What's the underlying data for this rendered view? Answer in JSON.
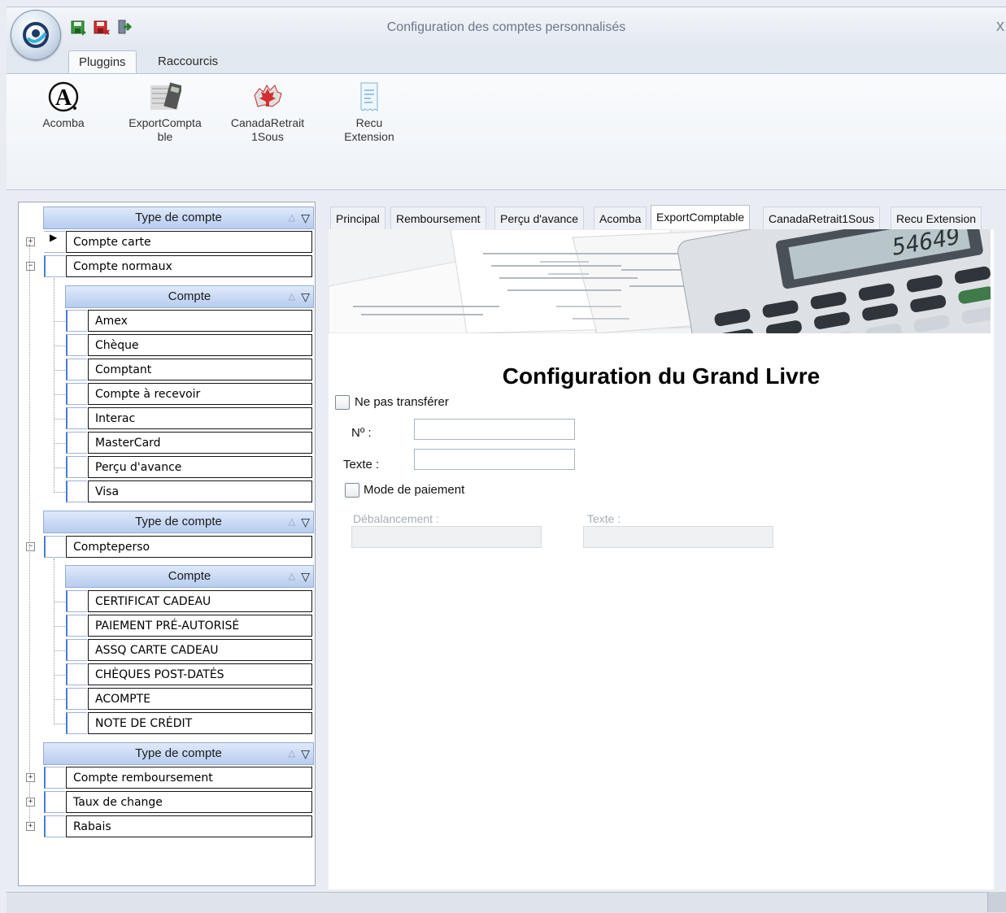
{
  "window": {
    "title": "Configuration des comptes personnalisés",
    "close_glyph": "x"
  },
  "quick_access": [
    {
      "icon": "save-icon",
      "color": "#2e7d32"
    },
    {
      "icon": "save-close-icon",
      "color": "#c62828"
    },
    {
      "icon": "exit-icon",
      "color": "#388e3c"
    }
  ],
  "ribbon": {
    "tabs": [
      "Pluggins",
      "Raccourcis"
    ],
    "active_tab": "Pluggins",
    "buttons": [
      {
        "label_line1": "Acomba",
        "label_line2": ""
      },
      {
        "label_line1": "ExportCompta",
        "label_line2": "ble"
      },
      {
        "label_line1": "CanadaRetrait",
        "label_line2": "1Sous"
      },
      {
        "label_line1": "Recu",
        "label_line2": "Extension"
      }
    ]
  },
  "tree": {
    "groups": [
      {
        "header": "Type de compte",
        "rows": [
          {
            "label": "Compte carte",
            "expander": "+",
            "current": true
          },
          {
            "label": "Compte normaux",
            "expander": "−",
            "current": false
          }
        ],
        "child": {
          "header": "Compte",
          "rows": [
            "Amex",
            "Chèque",
            "Comptant",
            "Compte à recevoir",
            "Interac",
            "MasterCard",
            "Perçu d'avance",
            "Visa"
          ]
        }
      },
      {
        "header": "Type de compte",
        "rows": [
          {
            "label": "Compteperso",
            "expander": "−",
            "current": false
          }
        ],
        "child": {
          "header": "Compte",
          "rows": [
            "CERTIFICAT CADEAU",
            "PAIEMENT PRÉ-AUTORISÉ",
            "ASSQ CARTE CADEAU",
            "CHÈQUES POST-DATÉS",
            "ACOMPTE",
            "NOTE DE CRÉDIT"
          ]
        }
      },
      {
        "header": "Type de compte",
        "rows": [
          {
            "label": "Compte remboursement",
            "expander": "+",
            "current": false
          },
          {
            "label": "Taux de change",
            "expander": "+",
            "current": false
          },
          {
            "label": "Rabais",
            "expander": "+",
            "current": false
          }
        ]
      }
    ]
  },
  "content_tabs": {
    "items": [
      "Principal",
      "Remboursement",
      "Perçu d'avance",
      "Acomba",
      "ExportComptable",
      "CanadaRetrait1Sous",
      "Recu Extension"
    ],
    "active": "ExportComptable"
  },
  "banner": {
    "calculator_display": "54649"
  },
  "form": {
    "title": "Configuration du Grand Livre",
    "no_transfer_label": "Ne pas transférer",
    "no_transfer_checked": false,
    "number_label": "Nº :",
    "number_value": "",
    "text_label": "Texte :",
    "text_value": "",
    "payment_mode_label": "Mode de paiement",
    "payment_mode_checked": false,
    "imbalance_label": "Débalancement :",
    "imbalance_value": "",
    "text2_label": "Texte :",
    "text2_value": ""
  },
  "colors": {
    "header_band": "#c9d8f3",
    "accent": "#4a7cd0"
  }
}
